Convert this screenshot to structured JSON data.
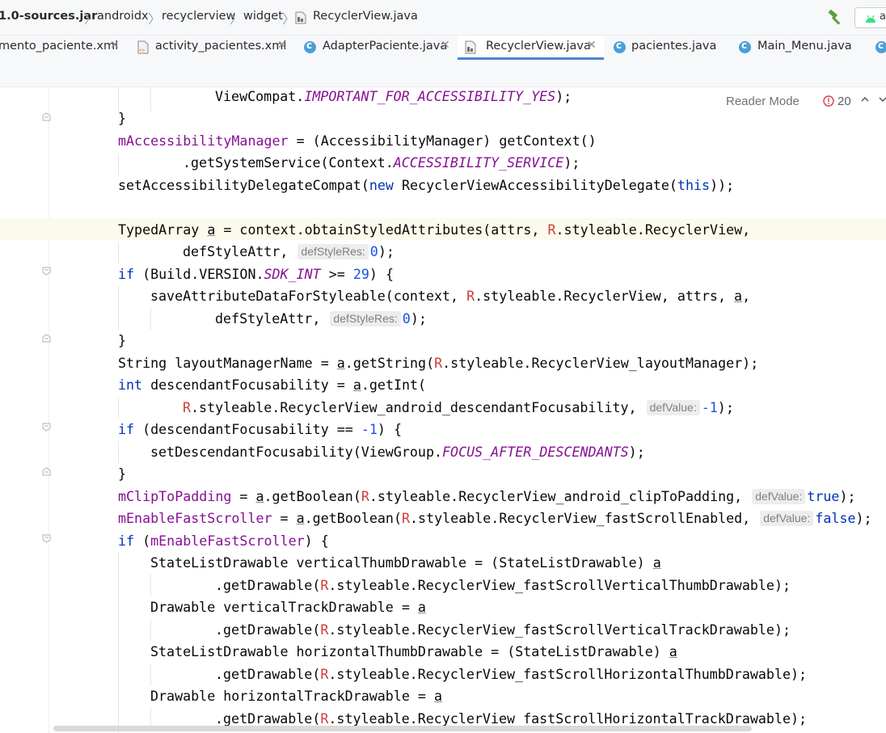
{
  "breadcrumb": {
    "items": [
      "1.0-sources.jar",
      "androidx",
      "recyclerview",
      "widget",
      "RecyclerView.java"
    ]
  },
  "run_config": {
    "label": "a"
  },
  "tabs": [
    {
      "label": "mento_paciente.xml",
      "icon": "xml-file-icon",
      "active": false
    },
    {
      "label": "activity_pacientes.xml",
      "icon": "xml-file-icon",
      "active": false
    },
    {
      "label": "AdapterPaciente.java",
      "icon": "java-class-icon",
      "active": false
    },
    {
      "label": "RecyclerView.java",
      "icon": "java-file-icon",
      "active": true
    },
    {
      "label": "pacientes.java",
      "icon": "java-class-icon",
      "active": false
    },
    {
      "label": "Main_Menu.java",
      "icon": "java-class-icon",
      "active": false
    }
  ],
  "editor": {
    "reader_mode": "Reader Mode",
    "error_count": "20"
  },
  "hints": {
    "def_style_res": "defStyleRes:",
    "def_value": "defValue:"
  },
  "colors": {
    "keyword": "#0033b3",
    "field": "#871094",
    "number": "#1750eb",
    "r_class": "#d23c3c",
    "active_tab_underline": "#4a83d6",
    "current_line": "#fcfaed"
  },
  "code": {
    "l1": [
      "ViewCompat.",
      "IMPORTANT_FOR_ACCESSIBILITY_YES",
      ");"
    ],
    "l2": "}",
    "l3": [
      "mAccessibilityManager",
      " = (AccessibilityManager) getContext()"
    ],
    "l4": [
      ".getSystemService(Context.",
      "ACCESSIBILITY_SERVICE",
      ");"
    ],
    "l5": [
      "setAccessibilityDelegateCompat(",
      "new",
      " RecyclerViewAccessibilityDelegate(",
      "this",
      "));"
    ],
    "l7": [
      "TypedArray ",
      "a",
      " = context.obtainStyledAttributes(attrs, ",
      "R",
      ".styleable.RecyclerView,"
    ],
    "l8": [
      "defStyleAttr, ",
      "0",
      ");"
    ],
    "l9": [
      "if",
      " (Build.VERSION.",
      "SDK_INT",
      " >= ",
      "29",
      ") {"
    ],
    "l10": [
      "saveAttributeDataForStyleable(context, ",
      "R",
      ".styleable.RecyclerView, attrs, ",
      "a",
      ","
    ],
    "l11": [
      "defStyleAttr, ",
      "0",
      ");"
    ],
    "l12": "}",
    "l13": [
      "String layoutManagerName = ",
      "a",
      ".getString(",
      "R",
      ".styleable.RecyclerView_layoutManager);"
    ],
    "l14": [
      "int",
      " descendantFocusability = ",
      "a",
      ".getInt("
    ],
    "l15": [
      "R",
      ".styleable.RecyclerView_android_descendantFocusability, ",
      "-1",
      ");"
    ],
    "l16": [
      "if",
      " (descendantFocusability == ",
      "-1",
      ") {"
    ],
    "l17": [
      "setDescendantFocusability(ViewGroup.",
      "FOCUS_AFTER_DESCENDANTS",
      ");"
    ],
    "l18": "}",
    "l19": [
      "mClipToPadding",
      " = ",
      "a",
      ".getBoolean(",
      "R",
      ".styleable.RecyclerView_android_clipToPadding, ",
      "true",
      ");"
    ],
    "l20": [
      "mEnableFastScroller",
      " = ",
      "a",
      ".getBoolean(",
      "R",
      ".styleable.RecyclerView_fastScrollEnabled, ",
      "false",
      ");"
    ],
    "l21": [
      "if",
      " (",
      "mEnableFastScroller",
      ") {"
    ],
    "l22": [
      "StateListDrawable verticalThumbDrawable = (StateListDrawable) ",
      "a"
    ],
    "l23": [
      ".getDrawable(",
      "R",
      ".styleable.RecyclerView_fastScrollVerticalThumbDrawable);"
    ],
    "l24": [
      "Drawable verticalTrackDrawable = ",
      "a"
    ],
    "l25": [
      ".getDrawable(",
      "R",
      ".styleable.RecyclerView_fastScrollVerticalTrackDrawable);"
    ],
    "l26": [
      "StateListDrawable horizontalThumbDrawable = (StateListDrawable) ",
      "a"
    ],
    "l27": [
      ".getDrawable(",
      "R",
      ".styleable.RecyclerView_fastScrollHorizontalThumbDrawable);"
    ],
    "l28": [
      "Drawable horizontalTrackDrawable = ",
      "a"
    ],
    "l29": [
      ".getDrawable(",
      "R",
      ".styleable.RecyclerView_fastScrollHorizontalTrackDrawable);"
    ]
  }
}
